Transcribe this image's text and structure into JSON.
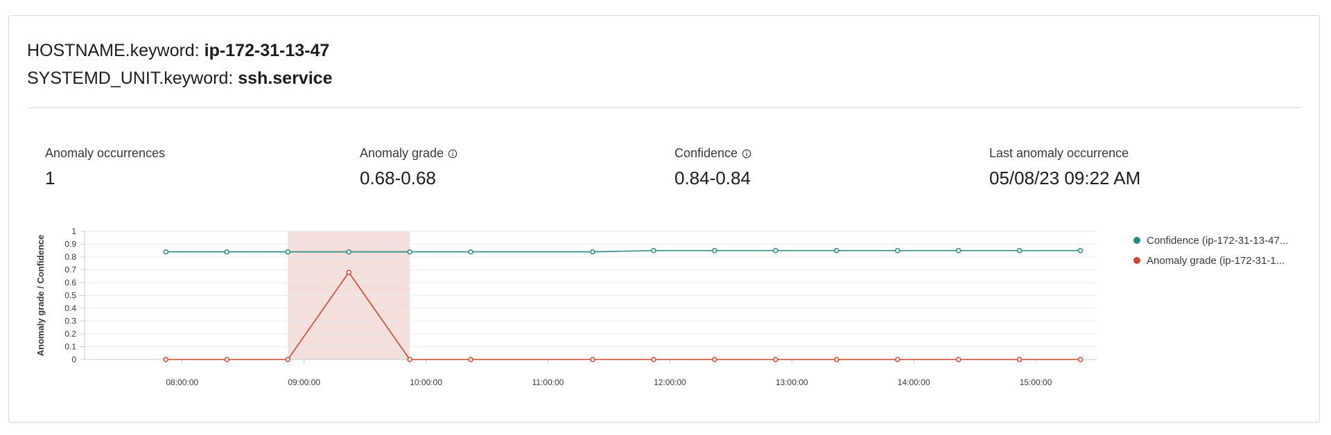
{
  "entities": [
    {
      "key": "HOSTNAME.keyword:",
      "value": "ip-172-31-13-47"
    },
    {
      "key": "SYSTEMD_UNIT.keyword:",
      "value": "ssh.service"
    }
  ],
  "stats": [
    {
      "label": "Anomaly occurrences",
      "value": "1",
      "info": false
    },
    {
      "label": "Anomaly grade",
      "value": "0.68-0.68",
      "info": true
    },
    {
      "label": "Confidence",
      "value": "0.84-0.84",
      "info": true
    },
    {
      "label": "Last anomaly occurrence",
      "value": "05/08/23 09:22 AM",
      "info": false
    }
  ],
  "colors": {
    "confidence": "#21897e",
    "anomaly": "#d6452b",
    "highlight": "#f3d9d6",
    "grid": "#e7eaf0"
  },
  "chart_data": {
    "type": "line",
    "ylabel": "Anomaly grade / Confidence",
    "ylim": [
      0,
      1
    ],
    "yticks": [
      "0",
      "0.1",
      "0.2",
      "0.3",
      "0.4",
      "0.5",
      "0.6",
      "0.7",
      "0.8",
      "0.9",
      "1"
    ],
    "xlim": [
      "07:12",
      "15:30"
    ],
    "xticks": [
      "08:00:00",
      "09:00:00",
      "10:00:00",
      "11:00:00",
      "12:00:00",
      "13:00:00",
      "14:00:00",
      "15:00:00"
    ],
    "highlight": {
      "from": "08:52",
      "to": "09:52"
    },
    "series": [
      {
        "name": "Confidence (ip-172-31-13-47...",
        "x": [
          "07:52",
          "08:22",
          "08:52",
          "09:22",
          "09:52",
          "10:22",
          "11:22",
          "11:52",
          "12:22",
          "12:52",
          "13:22",
          "13:52",
          "14:22",
          "14:52",
          "15:22"
        ],
        "values": [
          0.84,
          0.84,
          0.84,
          0.84,
          0.84,
          0.84,
          0.84,
          0.85,
          0.85,
          0.85,
          0.85,
          0.85,
          0.85,
          0.85,
          0.85
        ]
      },
      {
        "name": "Anomaly grade (ip-172-31-1...",
        "x": [
          "07:52",
          "08:22",
          "08:52",
          "09:22",
          "09:52",
          "10:22",
          "11:22",
          "11:52",
          "12:22",
          "12:52",
          "13:22",
          "13:52",
          "14:22",
          "14:52",
          "15:22"
        ],
        "values": [
          0,
          0,
          0,
          0.68,
          0,
          0,
          0,
          0,
          0,
          0,
          0,
          0,
          0,
          0,
          0
        ]
      }
    ],
    "legend": "right"
  }
}
